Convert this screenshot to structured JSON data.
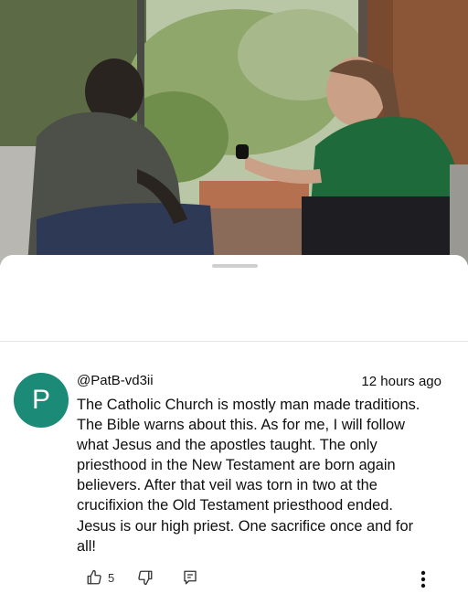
{
  "video": {
    "scene_icon": "interview-video-frame"
  },
  "comment": {
    "avatar_letter": "P",
    "avatar_color": "#1b8a76",
    "author": "@PatB-vd3ii",
    "time": "12 hours ago",
    "text": "The Catholic Church is mostly man made traditions.\nThe Bible warns about this. As for me, I will follow\nwhat Jesus and the apostles taught. The only\npriesthood in the New Testament are born again\nbelievers. After that veil was torn in two at the\ncrucifixion the Old Testament priesthood ended.\nJesus is our high priest. One sacrifice once and for\nall!",
    "like_count": "5"
  },
  "icons": {
    "like": "thumbs-up-icon",
    "dislike": "thumbs-down-icon",
    "reply": "reply-icon",
    "more": "more-vertical-icon"
  }
}
